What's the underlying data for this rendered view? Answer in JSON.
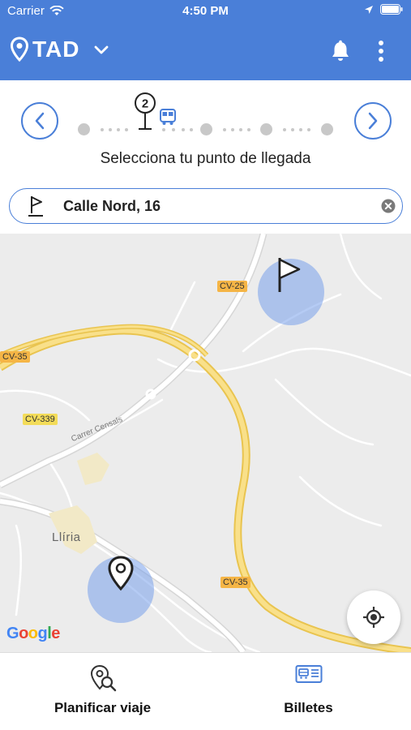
{
  "status_bar": {
    "carrier": "Carrier",
    "time": "4:50 PM"
  },
  "app_bar": {
    "title": "TAD",
    "accent_color": "#4a7fd8"
  },
  "stepper": {
    "current_step": "2",
    "title": "Selecciona tu punto de llegada"
  },
  "search": {
    "value": "Calle Nord, 16"
  },
  "map": {
    "roads": [
      "CV-25",
      "CV-35",
      "CV-339",
      "CV-35"
    ],
    "street": "Carrer Censals",
    "town": "Llíria",
    "google": {
      "letters": [
        "G",
        "o",
        "o",
        "g",
        "l",
        "e"
      ],
      "colors": [
        "#4285f4",
        "#ea4335",
        "#fbbc05",
        "#4285f4",
        "#34a853",
        "#ea4335"
      ]
    }
  },
  "tabs": [
    {
      "label": "Planificar viaje",
      "icon": "map-search-icon"
    },
    {
      "label": "Billetes",
      "icon": "ticket-icon"
    }
  ]
}
